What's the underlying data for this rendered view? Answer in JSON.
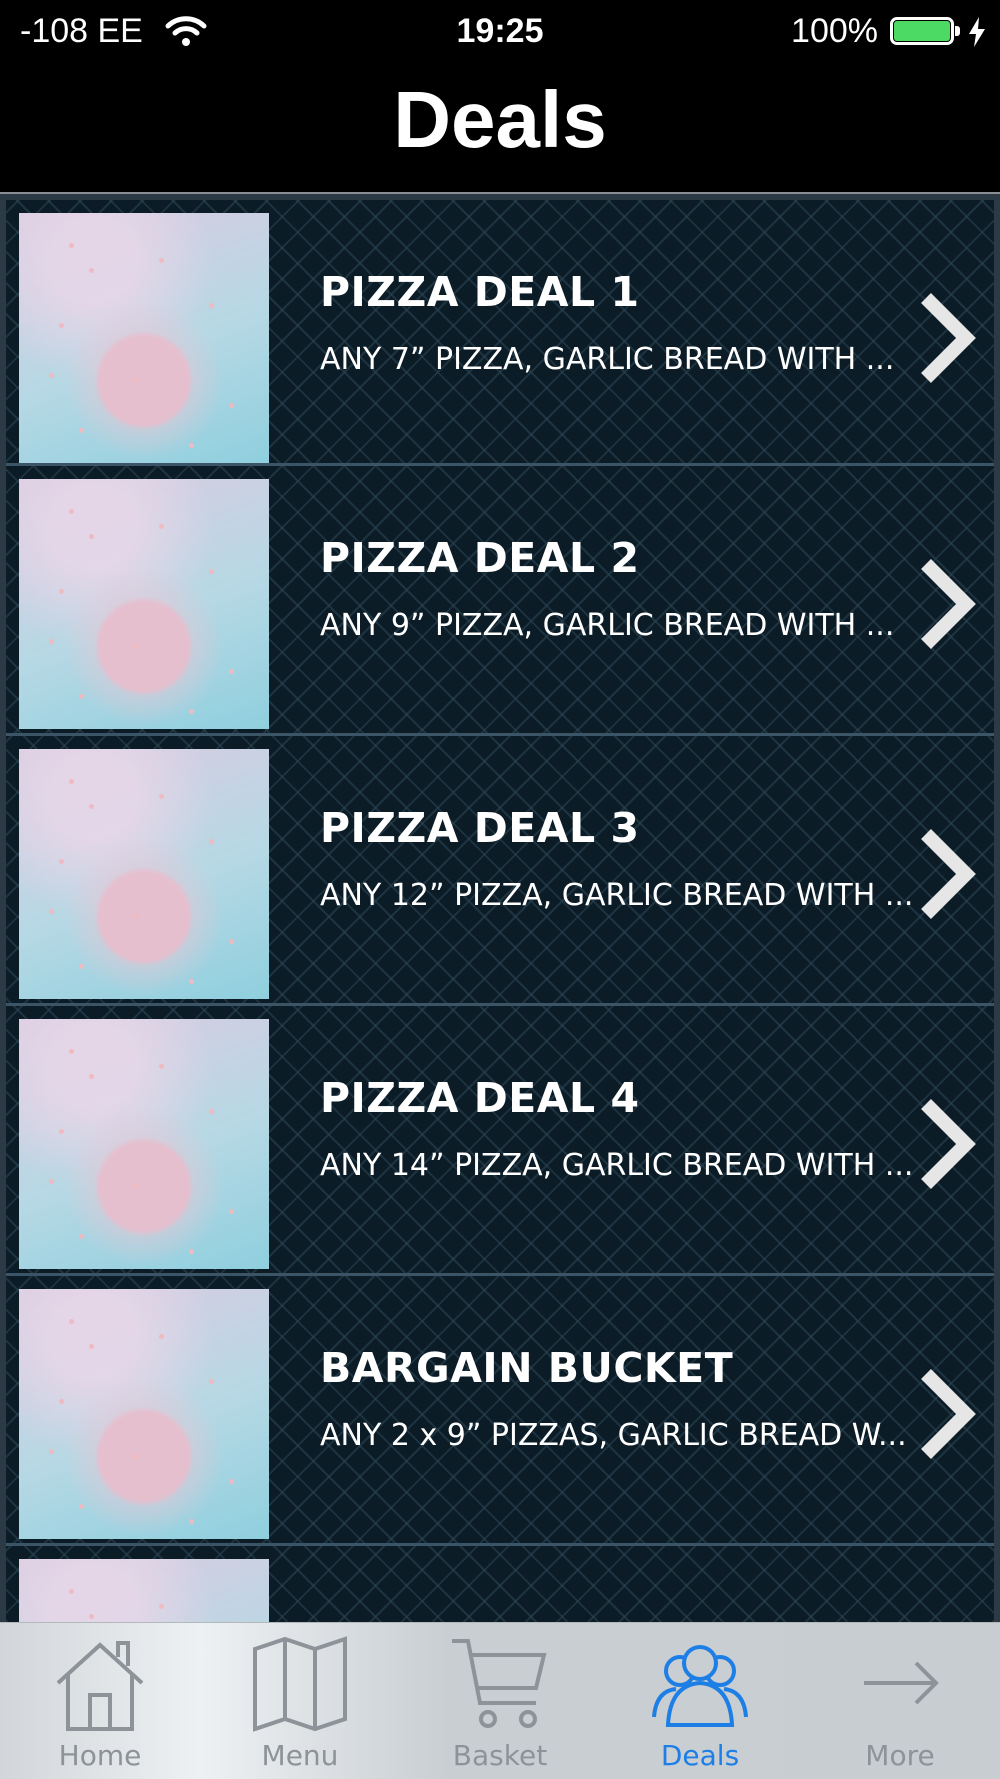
{
  "status_bar": {
    "carrier": "-108 EE",
    "time": "19:25",
    "battery": "100%"
  },
  "nav": {
    "title": "Deals"
  },
  "deals": [
    {
      "title": "PIZZA DEAL 1",
      "description": "ANY 7” PIZZA, GARLIC BREAD WITH ..."
    },
    {
      "title": "PIZZA DEAL 2",
      "description": "ANY 9” PIZZA, GARLIC BREAD WITH ..."
    },
    {
      "title": "PIZZA DEAL 3",
      "description": "ANY 12” PIZZA, GARLIC BREAD WITH ..."
    },
    {
      "title": "PIZZA DEAL 4",
      "description": "ANY 14” PIZZA, GARLIC BREAD WITH ..."
    },
    {
      "title": "BARGAIN BUCKET",
      "description": "ANY 2 x 9” PIZZAS, GARLIC BREAD W..."
    }
  ],
  "tab_bar": {
    "tabs": [
      {
        "label": "Home",
        "icon": "home-icon"
      },
      {
        "label": "Menu",
        "icon": "map-icon"
      },
      {
        "label": "Basket",
        "icon": "cart-icon"
      },
      {
        "label": "Deals",
        "icon": "people-icon",
        "active": true
      },
      {
        "label": "More",
        "icon": "arrow-right-icon"
      }
    ],
    "active_color": "#1d7fe6",
    "inactive_color": "#8e9399"
  },
  "colors": {
    "battery_fill": "#4cd964",
    "list_background": "#0c1c27"
  }
}
